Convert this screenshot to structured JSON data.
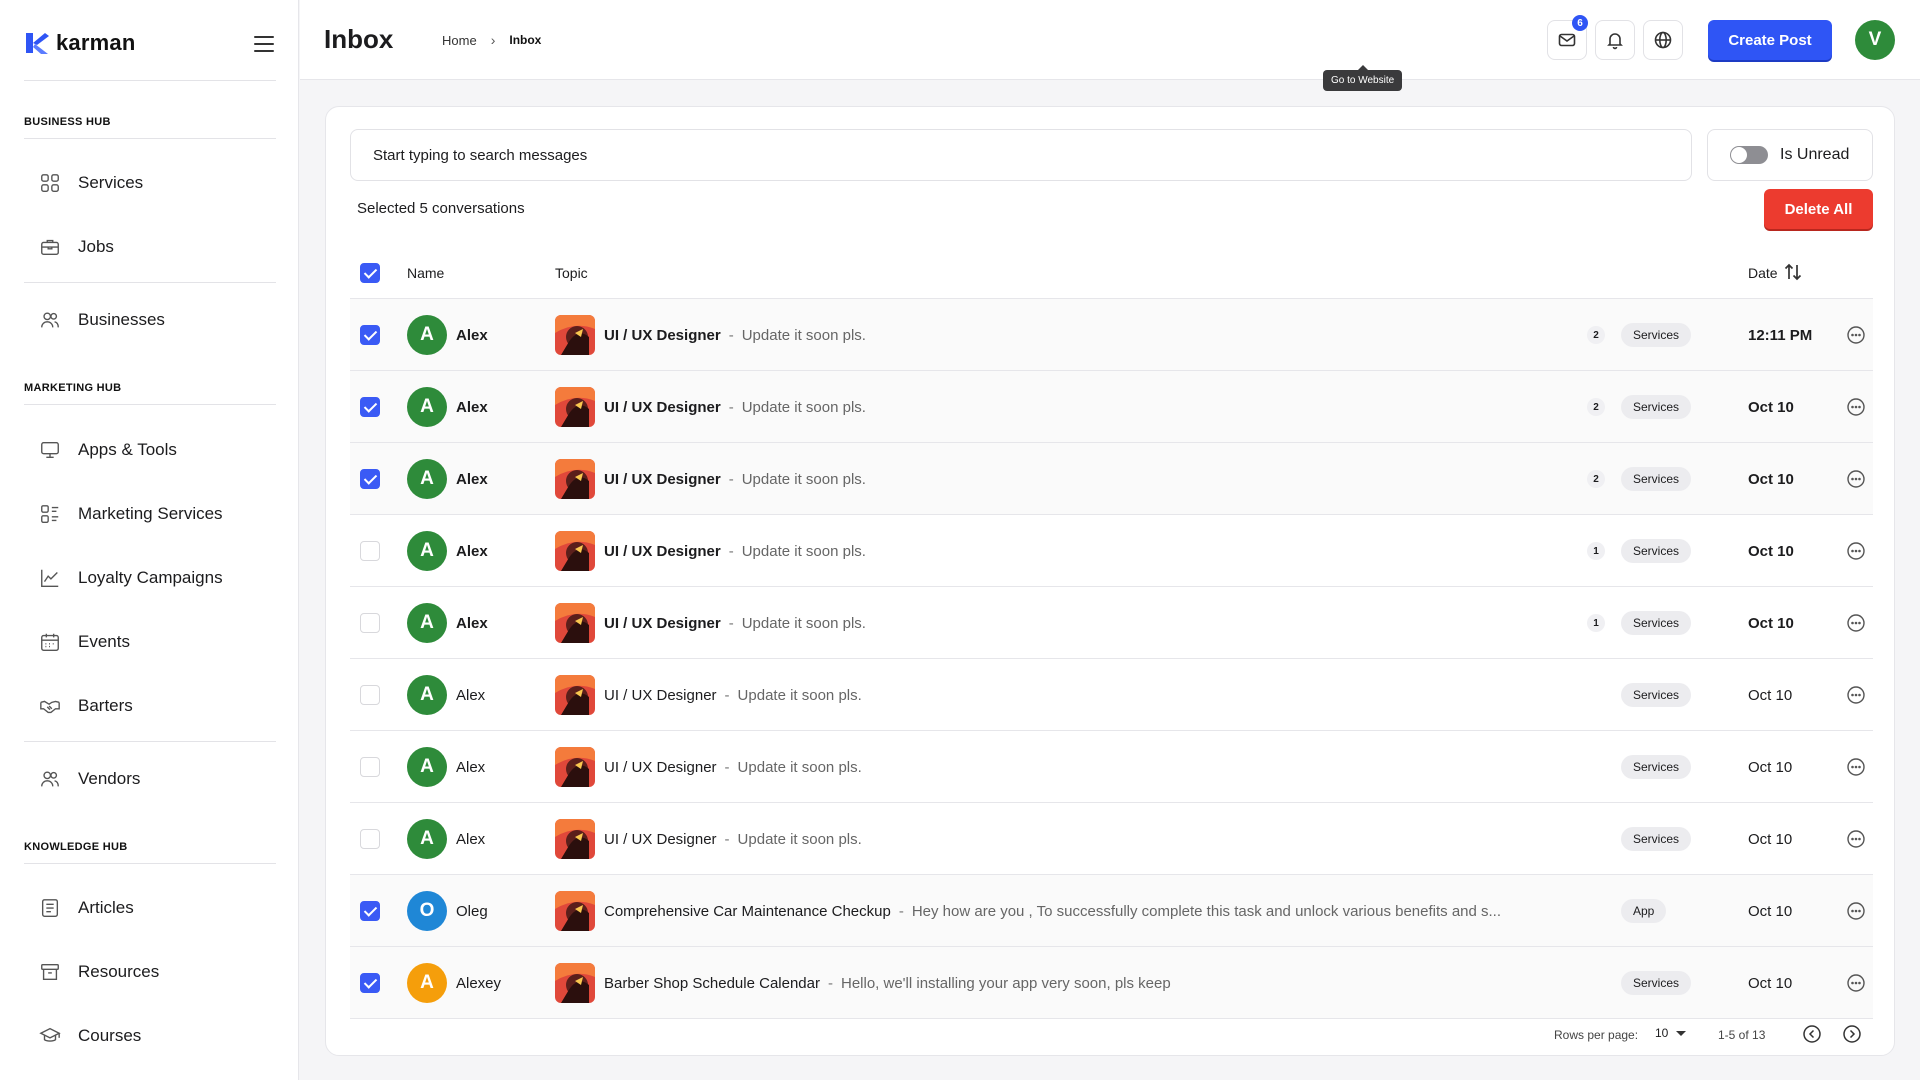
{
  "brand": {
    "name": "karman"
  },
  "sidebar": {
    "hubs": [
      {
        "title": "BUSINESS HUB",
        "items": [
          {
            "label": "Services",
            "icon": "grid-icon"
          },
          {
            "label": "Jobs",
            "icon": "briefcase-icon"
          },
          {
            "label": "Businesses",
            "icon": "people-icon"
          }
        ]
      },
      {
        "title": "MARKETING HUB",
        "items": [
          {
            "label": "Apps & Tools",
            "icon": "monitor-icon"
          },
          {
            "label": "Marketing Services",
            "icon": "list-grid-icon"
          },
          {
            "label": "Loyalty Campaigns",
            "icon": "chart-line-icon"
          },
          {
            "label": "Events",
            "icon": "calendar-icon"
          },
          {
            "label": "Barters",
            "icon": "handshake-icon"
          },
          {
            "label": "Vendors",
            "icon": "people-icon"
          }
        ]
      },
      {
        "title": "KNOWLEDGE HUB",
        "items": [
          {
            "label": "Articles",
            "icon": "article-icon"
          },
          {
            "label": "Resources",
            "icon": "archive-icon"
          },
          {
            "label": "Courses",
            "icon": "graduation-cap-icon"
          }
        ]
      }
    ]
  },
  "header": {
    "title": "Inbox",
    "breadcrumb": [
      "Home",
      "Inbox"
    ],
    "mail_badge": "6",
    "tooltip": "Go to Website",
    "create_label": "Create Post",
    "user_initial": "V"
  },
  "toolbar": {
    "search_placeholder": "Start typing to search messages",
    "unread_label": "Is Unread",
    "unread_on": false,
    "selected_text": "Selected 5 conversations",
    "delete_label": "Delete All"
  },
  "table": {
    "columns": {
      "name": "Name",
      "topic": "Topic",
      "date": "Date"
    },
    "all_checked": true,
    "rows": [
      {
        "checked": true,
        "bold": true,
        "initial": "A",
        "avatar_color": "#2e8b3a",
        "name": "Alex",
        "subject": "UI / UX Designer",
        "preview": "Update it soon pls.",
        "count": "2",
        "tag": "Services",
        "date": "12:11 PM"
      },
      {
        "checked": true,
        "bold": true,
        "initial": "A",
        "avatar_color": "#2e8b3a",
        "name": "Alex",
        "subject": "UI / UX Designer",
        "preview": "Update it soon pls.",
        "count": "2",
        "tag": "Services",
        "date": "Oct 10"
      },
      {
        "checked": true,
        "bold": true,
        "initial": "A",
        "avatar_color": "#2e8b3a",
        "name": "Alex",
        "subject": "UI / UX Designer",
        "preview": "Update it soon pls.",
        "count": "2",
        "tag": "Services",
        "date": "Oct 10"
      },
      {
        "checked": false,
        "bold": true,
        "initial": "A",
        "avatar_color": "#2e8b3a",
        "name": "Alex",
        "subject": "UI / UX Designer",
        "preview": "Update it soon pls.",
        "count": "1",
        "tag": "Services",
        "date": "Oct 10"
      },
      {
        "checked": false,
        "bold": true,
        "initial": "A",
        "avatar_color": "#2e8b3a",
        "name": "Alex",
        "subject": "UI / UX Designer",
        "preview": "Update it soon pls.",
        "count": "1",
        "tag": "Services",
        "date": "Oct 10"
      },
      {
        "checked": false,
        "bold": false,
        "initial": "A",
        "avatar_color": "#2e8b3a",
        "name": "Alex",
        "subject": "UI / UX Designer",
        "preview": "Update it soon pls.",
        "count": "",
        "tag": "Services",
        "date": "Oct 10"
      },
      {
        "checked": false,
        "bold": false,
        "initial": "A",
        "avatar_color": "#2e8b3a",
        "name": "Alex",
        "subject": "UI / UX Designer",
        "preview": "Update it soon pls.",
        "count": "",
        "tag": "Services",
        "date": "Oct 10"
      },
      {
        "checked": false,
        "bold": false,
        "initial": "A",
        "avatar_color": "#2e8b3a",
        "name": "Alex",
        "subject": "UI / UX Designer",
        "preview": "Update it soon pls.",
        "count": "",
        "tag": "Services",
        "date": "Oct 10"
      },
      {
        "checked": true,
        "bold": false,
        "initial": "O",
        "avatar_color": "#1f87d6",
        "name": "Oleg",
        "subject": "Comprehensive Car Maintenance Checkup",
        "preview": "Hey how are you , To successfully complete this task and unlock various benefits and s...",
        "count": "",
        "tag": "App",
        "date": "Oct 10"
      },
      {
        "checked": true,
        "bold": false,
        "initial": "A",
        "avatar_color": "#f59e0b",
        "name": "Alexey",
        "subject": "Barber Shop Schedule Calendar",
        "preview": "Hello, we'll installing your app very soon, pls keep",
        "count": "",
        "tag": "Services",
        "date": "Oct 10"
      }
    ]
  },
  "pagination": {
    "rows_label": "Rows per page:",
    "rows_value": "10",
    "range": "1-5 of 13"
  }
}
